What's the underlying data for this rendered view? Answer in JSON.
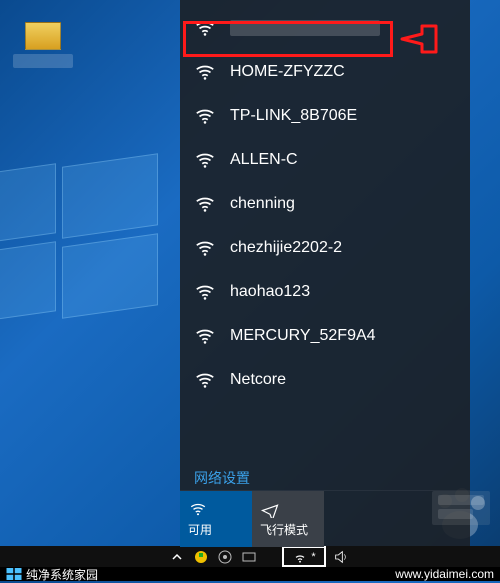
{
  "desktop": {
    "icon_label": ""
  },
  "wifi": {
    "current": "",
    "items": [
      "HOME-ZFYZZC",
      "TP-LINK_8B706E",
      "ALLEN-C",
      "chenning",
      "chezhijie2202-2",
      "haohao123",
      "MERCURY_52F9A4",
      "Netcore"
    ],
    "settings_label": "网络设置",
    "toggle_wifi": "可用",
    "toggle_airplane": "飞行模式"
  },
  "watermark": {
    "brand": "纯净系统家园",
    "url": "www.yidaimei.com"
  }
}
